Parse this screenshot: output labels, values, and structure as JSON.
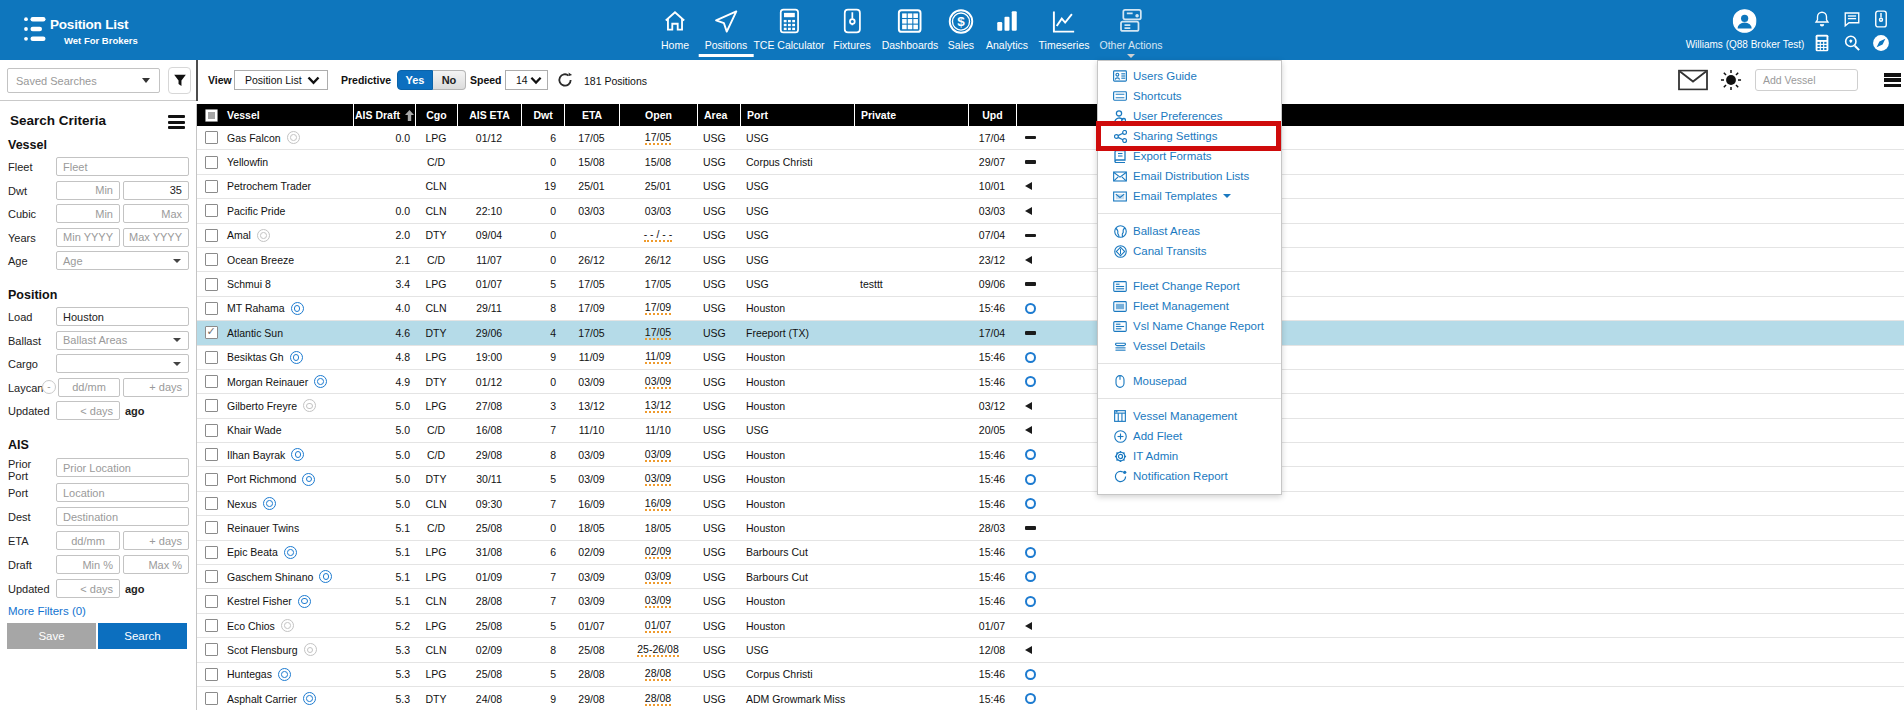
{
  "header": {
    "app_title": "Position List",
    "app_subtitle": "Wet For Brokers",
    "user_name": "Williams (Q88 Broker Test)",
    "brand_color": "#0e76bd",
    "nav": [
      {
        "label": "Home",
        "icon": "home"
      },
      {
        "label": "Positions",
        "icon": "positions",
        "active": true
      },
      {
        "label": "TCE Calculator",
        "icon": "calculator"
      },
      {
        "label": "Fixtures",
        "icon": "fixtures"
      },
      {
        "label": "Dashboards",
        "icon": "dashboards"
      },
      {
        "label": "Sales",
        "icon": "sales"
      },
      {
        "label": "Analytics",
        "icon": "analytics"
      },
      {
        "label": "Timeseries",
        "icon": "timeseries"
      },
      {
        "label": "Other Actions",
        "icon": "other-actions"
      }
    ]
  },
  "toolbar": {
    "saved_searches_placeholder": "Saved Searches",
    "view_label": "View",
    "view_value": "Position List",
    "predictive_label": "Predictive",
    "predictive_yes": "Yes",
    "predictive_no": "No",
    "speed_label": "Speed",
    "speed_value": "14",
    "positions_count": "181 Positions",
    "add_vessel_placeholder": "Add Vessel"
  },
  "sidebar": {
    "title": "Search Criteria",
    "vessel_heading": "Vessel",
    "fleet_label": "Fleet",
    "fleet_placeholder": "Fleet",
    "dwt_label": "Dwt",
    "dwt_min_placeholder": "Min",
    "dwt_max_value": "35",
    "cubic_label": "Cubic",
    "cubic_min_placeholder": "Min",
    "cubic_max_placeholder": "Max",
    "years_label": "Years",
    "years_min_placeholder": "Min YYYY",
    "years_max_placeholder": "Max YYYY",
    "age_label": "Age",
    "age_placeholder": "Age",
    "position_heading": "Position",
    "load_label": "Load",
    "load_value": "Houston",
    "ballast_label": "Ballast",
    "ballast_placeholder": "Ballast Areas",
    "cargo_label": "Cargo",
    "laycan_label": "Laycan",
    "laycan_toggle": "-",
    "laycan_date_placeholder": "dd/mm",
    "laycan_days_placeholder": "+ days",
    "updated_label": "Updated",
    "updated_days_placeholder": "< days",
    "updated_suffix": "ago",
    "ais_heading": "AIS",
    "prior_port_label": "Prior Port",
    "prior_port_placeholder": "Prior Location",
    "port_label": "Port",
    "port_placeholder": "Location",
    "dest_label": "Dest",
    "dest_placeholder": "Destination",
    "eta_label": "ETA",
    "eta_date_placeholder": "dd/mm",
    "eta_days_placeholder": "+ days",
    "draft_label": "Draft",
    "draft_min_placeholder": "Min %",
    "draft_max_placeholder": "Max %",
    "updated2_label": "Updated",
    "updated2_days_placeholder": "< days",
    "updated2_suffix": "ago",
    "more_filters_label": "More Filters (0)",
    "save_label": "Save",
    "search_label": "Search"
  },
  "table": {
    "columns": [
      "",
      "Vessel",
      "AIS Draft",
      "Cgo",
      "AIS ETA",
      "Dwt",
      "ETA",
      "Open",
      "Area",
      "Port",
      "Private",
      "Upd",
      ""
    ],
    "sort_column": "AIS Draft",
    "rows": [
      {
        "vessel": "Gas Falcon",
        "marker": "gray",
        "draft": "0.0",
        "cgo": "LPG",
        "ais_eta": "01/12",
        "dwt": "6",
        "eta": "17/05",
        "open": "17/05",
        "open_dotted": true,
        "area": "USG",
        "port": "USG",
        "private": "",
        "upd": "17/04",
        "status": "dash"
      },
      {
        "vessel": "Yellowfin",
        "marker": "none",
        "draft": "",
        "cgo": "C/D",
        "ais_eta": "",
        "dwt": "0",
        "eta": "15/08",
        "open": "15/08",
        "open_dotted": false,
        "area": "USG",
        "port": "Corpus Christi",
        "private": "",
        "upd": "29/07",
        "status": "dash"
      },
      {
        "vessel": "Petrochem Trader",
        "marker": "none",
        "draft": "",
        "cgo": "CLN",
        "ais_eta": "",
        "dwt": "19",
        "eta": "25/01",
        "open": "25/01",
        "open_dotted": false,
        "area": "USG",
        "port": "USG",
        "private": "",
        "upd": "10/01",
        "status": "triangle"
      },
      {
        "vessel": "Pacific Pride",
        "marker": "none",
        "draft": "0.0",
        "cgo": "CLN",
        "ais_eta": "22:10",
        "dwt": "0",
        "eta": "03/03",
        "open": "03/03",
        "open_dotted": false,
        "area": "USG",
        "port": "USG",
        "private": "",
        "upd": "03/03",
        "status": "triangle"
      },
      {
        "vessel": "Amal",
        "marker": "gray",
        "draft": "2.0",
        "cgo": "DTY",
        "ais_eta": "09/04",
        "dwt": "0",
        "eta": "",
        "open": "- - / - -",
        "open_dotted": true,
        "area": "USG",
        "port": "USG",
        "private": "",
        "upd": "07/04",
        "status": "dash"
      },
      {
        "vessel": "Ocean Breeze",
        "marker": "none",
        "draft": "2.1",
        "cgo": "C/D",
        "ais_eta": "11/07",
        "dwt": "0",
        "eta": "26/12",
        "open": "26/12",
        "open_dotted": false,
        "area": "USG",
        "port": "USG",
        "private": "",
        "upd": "23/12",
        "status": "triangle"
      },
      {
        "vessel": "Schmui 8",
        "marker": "none",
        "draft": "3.4",
        "cgo": "LPG",
        "ais_eta": "01/07",
        "dwt": "5",
        "eta": "17/05",
        "open": "17/05",
        "open_dotted": false,
        "area": "USG",
        "port": "USG",
        "private": "testtt",
        "upd": "09/06",
        "status": "dash"
      },
      {
        "vessel": "MT Rahama",
        "marker": "blue",
        "draft": "4.0",
        "cgo": "CLN",
        "ais_eta": "29/11",
        "dwt": "8",
        "eta": "17/09",
        "open": "17/09",
        "open_dotted": true,
        "area": "USG",
        "port": "Houston",
        "private": "",
        "upd": "15:46",
        "status": "circle"
      },
      {
        "vessel": "Atlantic Sun",
        "marker": "none",
        "draft": "4.6",
        "cgo": "DTY",
        "ais_eta": "29/06",
        "dwt": "4",
        "eta": "17/05",
        "open": "17/05",
        "open_dotted": true,
        "area": "USG",
        "port": "Freeport (TX)",
        "private": "",
        "upd": "17/04",
        "status": "dash",
        "selected": true,
        "checked": true
      },
      {
        "vessel": "Besiktas Gh",
        "marker": "blue",
        "draft": "4.8",
        "cgo": "LPG",
        "ais_eta": "19:00",
        "dwt": "9",
        "eta": "11/09",
        "open": "11/09",
        "open_dotted": true,
        "area": "USG",
        "port": "Houston",
        "private": "",
        "upd": "15:46",
        "status": "circle"
      },
      {
        "vessel": "Morgan Reinauer",
        "marker": "blue",
        "draft": "4.9",
        "cgo": "DTY",
        "ais_eta": "01/12",
        "dwt": "0",
        "eta": "03/09",
        "open": "03/09",
        "open_dotted": true,
        "area": "USG",
        "port": "Houston",
        "private": "",
        "upd": "15:46",
        "status": "circle"
      },
      {
        "vessel": "Gilberto Freyre",
        "marker": "gray",
        "draft": "5.0",
        "cgo": "LPG",
        "ais_eta": "27/08",
        "dwt": "3",
        "eta": "13/12",
        "open": "13/12",
        "open_dotted": true,
        "area": "USG",
        "port": "Houston",
        "private": "",
        "upd": "03/12",
        "status": "triangle"
      },
      {
        "vessel": "Khair Wade",
        "marker": "none",
        "draft": "5.0",
        "cgo": "C/D",
        "ais_eta": "16/08",
        "dwt": "7",
        "eta": "11/10",
        "open": "11/10",
        "open_dotted": false,
        "area": "USG",
        "port": "USG",
        "private": "",
        "upd": "20/05",
        "status": "triangle"
      },
      {
        "vessel": "Ilhan Bayrak",
        "marker": "blue",
        "draft": "5.0",
        "cgo": "C/D",
        "ais_eta": "29/08",
        "dwt": "8",
        "eta": "03/09",
        "open": "03/09",
        "open_dotted": true,
        "area": "USG",
        "port": "Houston",
        "private": "",
        "upd": "15:46",
        "status": "circle"
      },
      {
        "vessel": "Port Richmond",
        "marker": "blue",
        "draft": "5.0",
        "cgo": "DTY",
        "ais_eta": "30/11",
        "dwt": "5",
        "eta": "03/09",
        "open": "03/09",
        "open_dotted": true,
        "area": "USG",
        "port": "Houston",
        "private": "",
        "upd": "15:46",
        "status": "circle"
      },
      {
        "vessel": "Nexus",
        "marker": "blue",
        "draft": "5.0",
        "cgo": "CLN",
        "ais_eta": "09:30",
        "dwt": "7",
        "eta": "16/09",
        "open": "16/09",
        "open_dotted": true,
        "area": "USG",
        "port": "Houston",
        "private": "",
        "upd": "15:46",
        "status": "circle"
      },
      {
        "vessel": "Reinauer Twins",
        "marker": "none",
        "draft": "5.1",
        "cgo": "C/D",
        "ais_eta": "25/08",
        "dwt": "0",
        "eta": "18/05",
        "open": "18/05",
        "open_dotted": false,
        "area": "USG",
        "port": "Houston",
        "private": "",
        "upd": "28/03",
        "status": "dash"
      },
      {
        "vessel": "Epic Beata",
        "marker": "blue",
        "draft": "5.1",
        "cgo": "LPG",
        "ais_eta": "31/08",
        "dwt": "6",
        "eta": "02/09",
        "open": "02/09",
        "open_dotted": true,
        "area": "USG",
        "port": "Barbours Cut",
        "private": "",
        "upd": "15:46",
        "status": "circle"
      },
      {
        "vessel": "Gaschem Shinano",
        "marker": "blue",
        "draft": "5.1",
        "cgo": "LPG",
        "ais_eta": "01/09",
        "dwt": "7",
        "eta": "03/09",
        "open": "03/09",
        "open_dotted": true,
        "area": "USG",
        "port": "Barbours Cut",
        "private": "",
        "upd": "15:46",
        "status": "circle"
      },
      {
        "vessel": "Kestrel Fisher",
        "marker": "blue",
        "draft": "5.1",
        "cgo": "CLN",
        "ais_eta": "28/08",
        "dwt": "7",
        "eta": "03/09",
        "open": "03/09",
        "open_dotted": true,
        "area": "USG",
        "port": "Houston",
        "private": "",
        "upd": "15:46",
        "status": "circle"
      },
      {
        "vessel": "Eco Chios",
        "marker": "gray",
        "draft": "5.2",
        "cgo": "LPG",
        "ais_eta": "25/08",
        "dwt": "5",
        "eta": "01/07",
        "open": "01/07",
        "open_dotted": true,
        "area": "USG",
        "port": "Houston",
        "private": "",
        "upd": "01/07",
        "status": "triangle"
      },
      {
        "vessel": "Scot Flensburg",
        "marker": "gray",
        "draft": "5.3",
        "cgo": "CLN",
        "ais_eta": "02/09",
        "dwt": "8",
        "eta": "25/08",
        "open": "25-26/08",
        "open_dotted": true,
        "area": "USG",
        "port": "USG",
        "private": "",
        "upd": "12/08",
        "status": "triangle"
      },
      {
        "vessel": "Huntegas",
        "marker": "blue",
        "draft": "5.3",
        "cgo": "LPG",
        "ais_eta": "25/08",
        "dwt": "5",
        "eta": "28/08",
        "open": "28/08",
        "open_dotted": true,
        "area": "USG",
        "port": "Corpus Christi",
        "private": "",
        "upd": "15:46",
        "status": "circle"
      },
      {
        "vessel": "Asphalt Carrier",
        "marker": "blue",
        "draft": "5.3",
        "cgo": "DTY",
        "ais_eta": "24/08",
        "dwt": "9",
        "eta": "29/08",
        "open": "28/08",
        "open_dotted": true,
        "area": "USG",
        "port": "ADM Growmark Miss",
        "private": "",
        "upd": "15:46",
        "status": "circle"
      }
    ]
  },
  "menu": {
    "groups": [
      [
        {
          "label": "Users Guide",
          "icon": "users-guide"
        },
        {
          "label": "Shortcuts",
          "icon": "shortcuts"
        },
        {
          "label": "User Preferences",
          "icon": "user-preferences"
        },
        {
          "label": "Sharing Settings",
          "icon": "sharing-settings",
          "annotated": true
        },
        {
          "label": "Export Formats",
          "icon": "export-formats"
        },
        {
          "label": "Email Distribution Lists",
          "icon": "email-distribution-lists"
        },
        {
          "label": "Email Templates",
          "icon": "email-templates",
          "caret": true
        }
      ],
      [
        {
          "label": "Ballast Areas",
          "icon": "ballast-areas"
        },
        {
          "label": "Canal Transits",
          "icon": "canal-transits"
        }
      ],
      [
        {
          "label": "Fleet Change Report",
          "icon": "fleet-change-report"
        },
        {
          "label": "Fleet Management",
          "icon": "fleet-management"
        },
        {
          "label": "Vsl Name Change Report",
          "icon": "vsl-name-change-report"
        },
        {
          "label": "Vessel Details",
          "icon": "vessel-details"
        }
      ],
      [
        {
          "label": "Mousepad",
          "icon": "mousepad"
        }
      ],
      [
        {
          "label": "Vessel Management",
          "icon": "vessel-management"
        },
        {
          "label": "Add Fleet",
          "icon": "add-fleet"
        },
        {
          "label": "IT Admin",
          "icon": "it-admin"
        },
        {
          "label": "Notification Report",
          "icon": "notification-report"
        }
      ]
    ],
    "annotation_color": "#cf0b0b"
  }
}
